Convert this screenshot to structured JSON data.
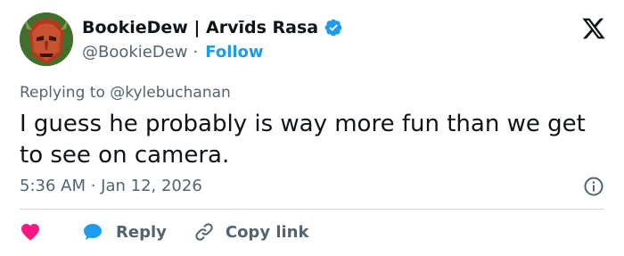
{
  "author": {
    "display_name": "BookieDew | Arvīds Rasa",
    "handle": "@BookieDew",
    "separator": "·",
    "follow_label": "Follow"
  },
  "reply_context": {
    "prefix": "Replying to",
    "mention": "@kylebuchanan"
  },
  "tweet": {
    "text": "I guess he probably is way more fun than we get to see on camera.",
    "timestamp": "5:36 AM · Jan 12, 2026"
  },
  "actions": {
    "reply_label": "Reply",
    "copy_link_label": "Copy link"
  },
  "colors": {
    "accent": "#1d9bf0",
    "like": "#f91880",
    "secondary_text": "#536471",
    "divider": "#cfd9de"
  },
  "icons": [
    "verified-badge-icon",
    "x-logo-icon",
    "info-icon",
    "heart-icon",
    "reply-bubble-icon",
    "link-icon"
  ]
}
